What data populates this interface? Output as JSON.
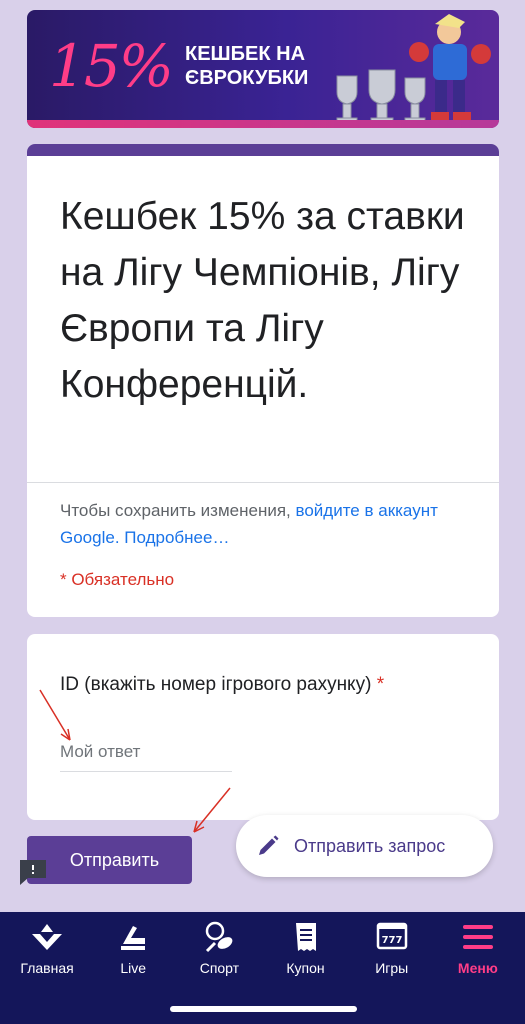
{
  "banner": {
    "percent": "15%",
    "line1": "КЕШБЕК НА",
    "line2": "ЄВРОКУБКИ",
    "colors": {
      "accent": "#ff3d87",
      "bg": "#3a2394"
    }
  },
  "form": {
    "title": "Кешбек 15% за ставки на Лігу Чемпіонів, Лігу Європи та Лігу Конференцій.",
    "note_prefix": "Чтобы сохранить изменения,",
    "note_link": "войдите в аккаунт Google.",
    "note_more": "Подробнее…",
    "required": "* Обязательно",
    "question": {
      "label": "ID (вкажіть номер ігрового рахунку)",
      "required_mark": "*",
      "placeholder": "Мой ответ"
    },
    "submit_label": "Отправить",
    "accent_color": "#5b3e96"
  },
  "send_request": {
    "label": "Отправить запрос",
    "icon": "pencil-icon"
  },
  "bottom_nav": {
    "items": [
      {
        "label": "Главная",
        "icon": "home-icon",
        "active": false
      },
      {
        "label": "Live",
        "icon": "live-icon",
        "active": false
      },
      {
        "label": "Спорт",
        "icon": "sport-icon",
        "active": false
      },
      {
        "label": "Купон",
        "icon": "coupon-icon",
        "active": false
      },
      {
        "label": "Игры",
        "icon": "games-icon",
        "active": false
      },
      {
        "label": "Меню",
        "icon": "menu-icon",
        "active": true
      }
    ],
    "active_color": "#ff3d87"
  }
}
